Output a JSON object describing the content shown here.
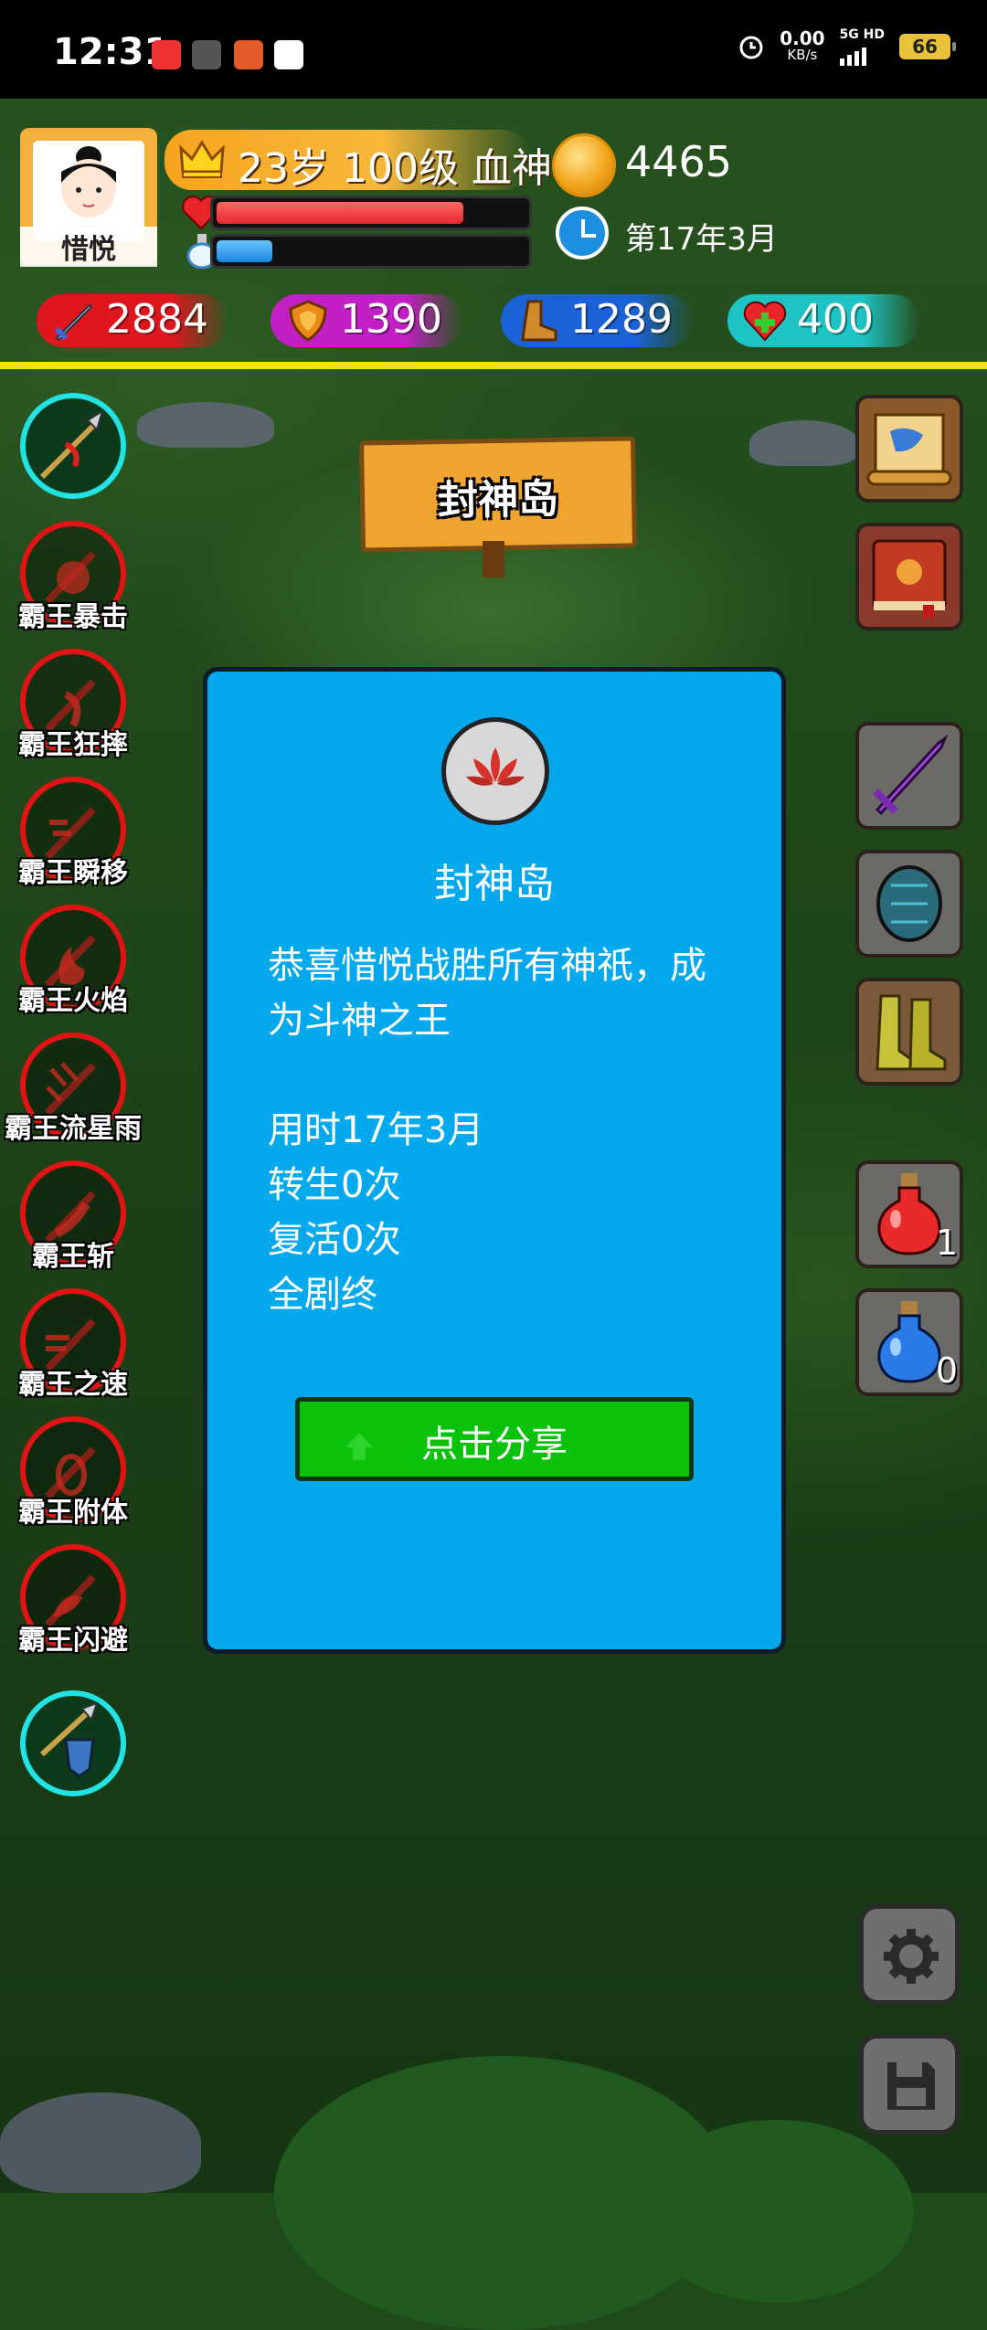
{
  "status_bar": {
    "time": "12:31",
    "net_speed": "0.00",
    "net_unit": "KB/s",
    "net_type": "5G HD",
    "battery": "66"
  },
  "player": {
    "name": "惜悦",
    "level_text": "23岁 100级 血神",
    "hp_fraction": 0.8,
    "mp_fraction": 0.18,
    "gold": "4465",
    "date": "第17年3月"
  },
  "stats": [
    {
      "icon": "sword-icon",
      "value": "2884",
      "color": "#e0161e"
    },
    {
      "icon": "shield-icon",
      "value": "1390",
      "color": "#c21fc4"
    },
    {
      "icon": "boot-icon",
      "value": "1289",
      "color": "#1b62d8"
    },
    {
      "icon": "heart-plus-icon",
      "value": "400",
      "color": "#1ec4c4"
    }
  ],
  "skills": [
    {
      "label": "霸王暴击"
    },
    {
      "label": "霸王狂摔"
    },
    {
      "label": "霸王瞬移"
    },
    {
      "label": "霸王火焰"
    },
    {
      "label": "霸王流星雨"
    },
    {
      "label": "霸王斩"
    },
    {
      "label": "霸王之速"
    },
    {
      "label": "霸王附体"
    },
    {
      "label": "霸王闪避"
    }
  ],
  "sign": {
    "text": "封神岛"
  },
  "dialog": {
    "title": "封神岛",
    "message": "恭喜惜悦战胜所有神祇，成为斗神之王",
    "lines": [
      "用时17年3月",
      "转生0次",
      "复活0次",
      "全剧终"
    ],
    "share_label": "点击分享"
  },
  "potions": {
    "red_count": "1",
    "blue_count": "0"
  },
  "colors": {
    "dialog_bg": "#03a9ec",
    "share_btn": "#0ac20a",
    "divider": "#f3e013"
  }
}
